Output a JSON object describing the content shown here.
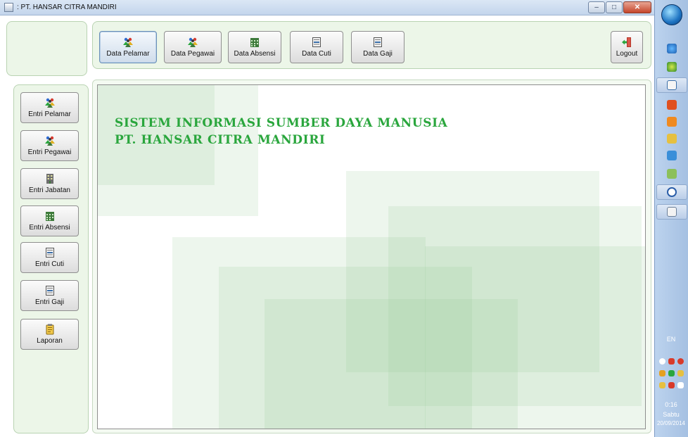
{
  "window": {
    "title": ": PT. HANSAR CITRA MANDIRI",
    "icon": "java-app-icon",
    "controls": [
      "minimize-icon",
      "maximize-icon",
      "close-icon"
    ]
  },
  "toolbar": {
    "items": [
      {
        "label": "Data Pelamar",
        "icon": "people-icon",
        "active": true
      },
      {
        "label": "Data Pegawai",
        "icon": "people-icon",
        "active": false
      },
      {
        "label": "Data Absensi",
        "icon": "calendar-icon",
        "active": false
      },
      {
        "label": "Data Cuti",
        "icon": "document-icon",
        "active": false
      },
      {
        "label": "Data Gaji",
        "icon": "document-icon",
        "active": false
      }
    ],
    "logout_label": "Logout"
  },
  "sidebar": {
    "items": [
      {
        "label": "Entri Pelamar",
        "icon": "people-icon"
      },
      {
        "label": "Entri Pegawai",
        "icon": "people-icon"
      },
      {
        "label": "Entri Jabatan",
        "icon": "building-icon"
      },
      {
        "label": "Entri Absensi",
        "icon": "calendar-icon"
      },
      {
        "label": "Entri Cuti",
        "icon": "document-icon"
      },
      {
        "label": "Entri Gaji",
        "icon": "document-icon"
      },
      {
        "label": "Laporan",
        "icon": "notepad-icon"
      }
    ]
  },
  "content": {
    "heading_line1": "SISTEM INFORMASI SUMBER DAYA MANUSIA",
    "heading_line2": "PT. HANSAR CITRA MANDIRI",
    "heading_color": "#2aa63d"
  },
  "taskbar": {
    "language": "EN",
    "time": "0:16",
    "day": "Sabtu",
    "date": "20/09/2014"
  }
}
